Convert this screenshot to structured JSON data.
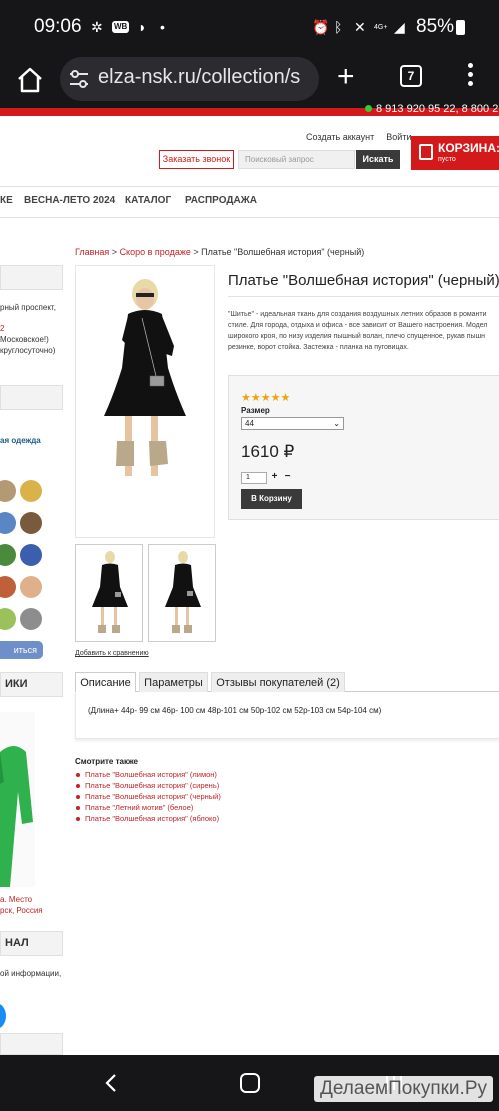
{
  "status_bar": {
    "time": "09:06",
    "wb_badge": "WB",
    "network": "4G+",
    "battery": "85%"
  },
  "browser": {
    "url": "elza-nsk.ru/collection/s",
    "tab_count": "7"
  },
  "top_bar": {
    "phones": "8 913 920 95 22, 8 800 2"
  },
  "header": {
    "create_account": "Создать аккаунт",
    "login": "Войти",
    "callback_button": "Заказать звонок",
    "search_placeholder": "Поисковый запрос",
    "search_button": "Искать",
    "cart_title": "КОРЗИНА:",
    "cart_status": "пусто"
  },
  "nav": {
    "items": [
      "КЕ",
      "ВЕСНА-ЛЕТО 2024",
      "КАТАЛОГ",
      "РАСПРОДАЖА"
    ]
  },
  "sidebar": {
    "address_lines": [
      "рный проспект,",
      "",
      "2",
      "Московское!)",
      "круглосуточно)"
    ],
    "link": "ая одежда",
    "subscribe_button": "иться",
    "heading_1": "ИКИ",
    "caption_lines": [
      "а. Место",
      "рск, Россия"
    ],
    "heading_2": "НАЛ",
    "info_lines": [
      "ой информации,"
    ]
  },
  "breadcrumb": {
    "home": "Главная",
    "category": "Скоро в продаже",
    "separator": ">",
    "current": "Платье \"Волшебная история\" (черный)"
  },
  "product": {
    "title": "Платье \"Волшебная история\" (черный)",
    "description_lines": [
      "\"Шитье\" - идеальная ткань для создания воздушных летних образов в романти",
      "стиле. Для города, отдыха и офиса - все зависит от Вашего настроения. Модел",
      "широкого кроя, по низу изделия пышный волан, плечо спущенное, рукав пышн",
      "резинке, ворот стойка. Застежка - планка на пуговицах."
    ],
    "rating": 5,
    "stars": "★★★★★",
    "size_label": "Размер",
    "size_value": "44",
    "price": "1610 ₽",
    "qty_value": "1",
    "plus": "+",
    "minus": "−",
    "add_to_cart": "В Корзину",
    "compare_link": "Добавить к сравнению"
  },
  "tabs": [
    "Описание",
    "Параметры",
    "Отзывы покупателей (2)"
  ],
  "sizes_line": "(Длина+ 44р- 99 см   46р- 100 см   48р-101 см   50р-102 см   52р-103 см   54р-104 см)",
  "see_also": {
    "title": "Смотрите также",
    "items": [
      "Платье \"Волшебная история\" (лимон)",
      "Платье \"Волшебная история\" (сирень)",
      "Платье \"Волшебная история\" (черный)",
      "Платье \"Летний мотив\" (белое)",
      "Платье \"Волшебная история\" (яблоко)"
    ]
  },
  "watermark": "ДелаемПокупки.Ру",
  "colors": {
    "brand_red": "#d4191b",
    "link_red": "#c42224",
    "dark_ui": "#161618",
    "button_dark": "#3a3a3a",
    "star": "#f2a20a"
  }
}
